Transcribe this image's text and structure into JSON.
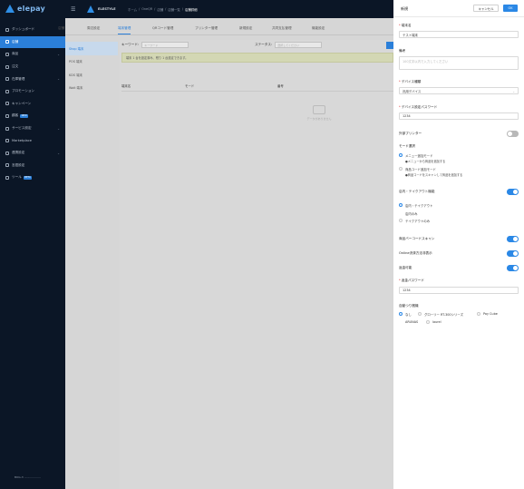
{
  "brand": {
    "logo": "elepay"
  },
  "sidebar": {
    "items": [
      {
        "label": "ダッシュボード",
        "icon": "dashboard-icon",
        "chevron": false,
        "active": false
      },
      {
        "label": "店舗",
        "icon": "store-icon",
        "chevron": false,
        "active": true
      },
      {
        "label": "商品",
        "icon": "product-icon",
        "chevron": true,
        "active": false
      },
      {
        "label": "注文",
        "icon": "order-icon",
        "chevron": false,
        "active": false
      },
      {
        "label": "在庫管理",
        "icon": "inventory-icon",
        "chevron": true,
        "active": false
      },
      {
        "label": "プロモーション",
        "icon": "promotion-icon",
        "chevron": false,
        "active": false
      },
      {
        "label": "キャンペーン",
        "icon": "campaign-icon",
        "chevron": false,
        "active": false
      },
      {
        "label": "顧客",
        "icon": "customer-icon",
        "chevron": false,
        "active": false,
        "badge": "NEW"
      },
      {
        "label": "サービス設定",
        "icon": "service-icon",
        "chevron": true,
        "active": false
      },
      {
        "label": "Marketplace",
        "icon": "marketplace-icon",
        "chevron": false,
        "active": false
      },
      {
        "label": "連携設定",
        "icon": "link-icon",
        "chevron": true,
        "active": false
      },
      {
        "label": "言語設定",
        "icon": "language-icon",
        "chevron": false,
        "active": false
      },
      {
        "label": "ツール",
        "icon": "tool-icon",
        "chevron": false,
        "active": false,
        "badge": "BETA"
      }
    ],
    "footer": "BOG-3 ..................."
  },
  "topbar": {
    "brand": "ELESTYLE",
    "breadcrumb": [
      "ホーム",
      "OneQR",
      "店舗",
      "店舗一覧"
    ],
    "current": "店舗詳細"
  },
  "tabs": [
    "店舗",
    "周辺設定",
    "端末管理",
    "QRコード管理",
    "プリンター管理",
    "新規設定",
    "共同支払管理",
    "機能設定"
  ],
  "active_tab": 2,
  "subnav": [
    "Shop 端末",
    "POS 端末",
    "KDS 端末",
    "Wait 端末"
  ],
  "filter": {
    "keyword_label": "キーワード:",
    "keyword_placeholder": "キーワード",
    "status_label": "ステータス:",
    "status_placeholder": "選択してください"
  },
  "notice": "端末 1 台を設定済み、残り 1 台設定できます。",
  "table": {
    "headers": [
      "端末名",
      "モード",
      "番号"
    ],
    "empty": "データがありません"
  },
  "drawer": {
    "title": "新規",
    "cancel": "キャンセル",
    "ok": "OK",
    "name_label": "端末名",
    "name_value": "テスト端末",
    "memo_label": "備考",
    "memo_placeholder": "100文字以内で入力してください",
    "device_type_label": "デバイス種類",
    "device_type_value": "汎用デバイス",
    "device_pw_label": "デバイス設定パスワード",
    "device_pw_value": "1234",
    "ext_printer_label": "外部プリンター",
    "ext_printer_on": false,
    "mode_label": "モード選択",
    "modes": [
      {
        "title": "メニュー追加モード",
        "sub": "●メニューから商品を追加する",
        "selected": true
      },
      {
        "title": "商品コード追加モード",
        "sub": "●商品コードをスキャンして商品を追加する",
        "selected": false
      }
    ],
    "dine_label": "店内・テイクアウト機能",
    "dine_on": true,
    "dine_options": [
      {
        "label": "店内・テイクアウト",
        "selected": true
      },
      {
        "label": "店内のみ",
        "selected": false
      },
      {
        "label": "テイクアウトのみ",
        "selected": false
      }
    ],
    "barcode_label": "商品バーコードスキャン",
    "barcode_on": true,
    "online_label": "Online決済方法非表示",
    "online_on": true,
    "refund_label": "返金可能",
    "refund_on": true,
    "refund_pw_label": "返金パスワード",
    "refund_pw_value": "1234",
    "change_label": "自動つり銭機",
    "change_options": [
      {
        "label": "なし",
        "selected": true
      },
      {
        "label": "グローリー RT-300シリーズ",
        "selected": false
      },
      {
        "label": "Pay Cube",
        "selected": false
      },
      {
        "label": "ARUNAS",
        "selected": false
      },
      {
        "label": "laurel",
        "selected": false
      }
    ]
  },
  "colors": {
    "accent": "#2b88e6",
    "sidebar_bg": "#0b1626",
    "overlay": "#6b6b6b"
  }
}
